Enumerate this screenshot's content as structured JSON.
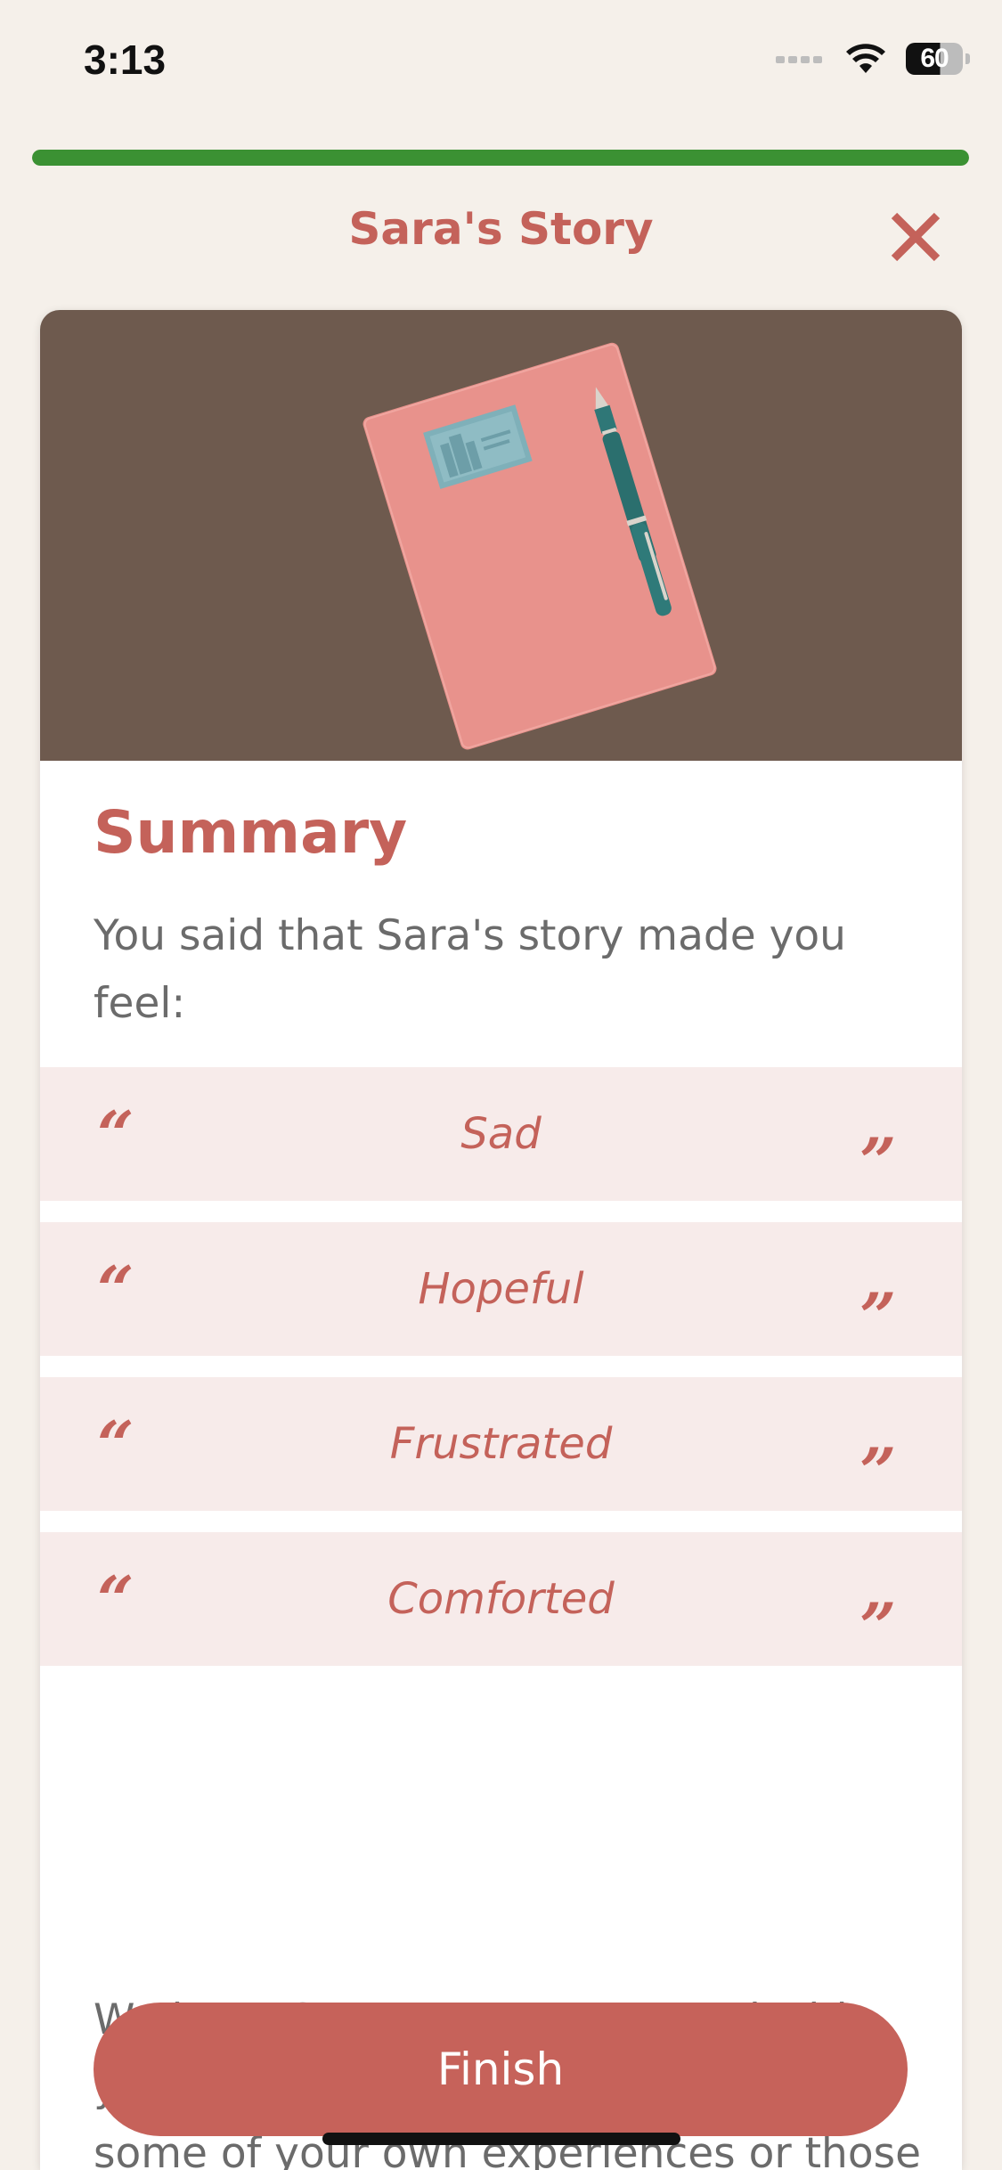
{
  "status_bar": {
    "time": "3:13",
    "battery": "60",
    "icons": [
      "cellular-signal-icon",
      "wifi-icon",
      "battery-icon"
    ]
  },
  "progress": {
    "fraction": 1.0,
    "color": "#3b9133"
  },
  "header": {
    "title": "Sara's Story",
    "close_icon": "close-icon"
  },
  "hero": {
    "image": "notebook-and-fountain-pen-illustration"
  },
  "summary": {
    "title": "Summary",
    "intro": "You said that Sara's story made you feel:",
    "feelings": [
      {
        "label": "Sad"
      },
      {
        "label": "Hopeful"
      },
      {
        "label": "Frustrated"
      },
      {
        "label": "Comforted"
      }
    ],
    "quote_open": "“",
    "quote_close": "”",
    "closing": "We hope Sara's story resonated with you, and helped you gain insight into some of your own experiences or those of people you know."
  },
  "actions": {
    "finish_label": "Finish"
  },
  "colors": {
    "accent": "#c4625a",
    "background": "#f5f0ea",
    "feeling_bg": "#f7ebea",
    "body_text": "#6b6b6b"
  }
}
